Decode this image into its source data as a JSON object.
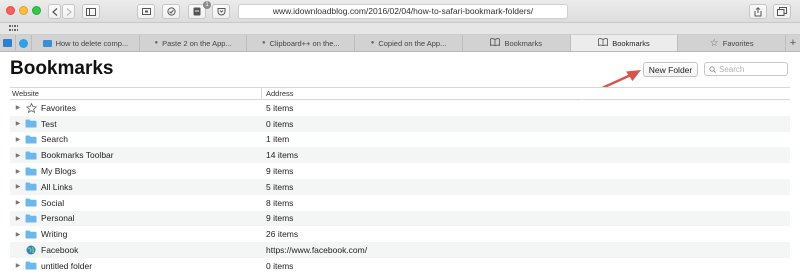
{
  "browser": {
    "url": "www.idownloadblog.com/2016/02/04/how-to-safari-bookmark-folders/",
    "badge_count": "1"
  },
  "tabs": [
    {
      "label": "How to delete comp...",
      "icon": "blue-favicon",
      "active": false
    },
    {
      "label": "Paste 2 on the App...",
      "icon": "apple-icon",
      "active": false
    },
    {
      "label": "Clipboard++ on the...",
      "icon": "apple-icon",
      "active": false
    },
    {
      "label": "Copied on the App...",
      "icon": "apple-icon",
      "active": false
    },
    {
      "label": "Bookmarks",
      "icon": "book-icon",
      "active": false
    },
    {
      "label": "Bookmarks",
      "icon": "book-icon",
      "active": true
    },
    {
      "label": "Favorites",
      "icon": "star-icon",
      "active": false
    }
  ],
  "page": {
    "title": "Bookmarks",
    "new_folder_label": "New Folder",
    "search_placeholder": "Search"
  },
  "table": {
    "headers": {
      "website": "Website",
      "address": "Address"
    },
    "rows": [
      {
        "name": "Favorites",
        "address": "5 items",
        "icon": "star-icon",
        "expandable": true
      },
      {
        "name": "Test",
        "address": "0 items",
        "icon": "folder-icon",
        "expandable": true
      },
      {
        "name": "Search",
        "address": "1 item",
        "icon": "folder-icon",
        "expandable": true
      },
      {
        "name": "Bookmarks Toolbar",
        "address": "14 items",
        "icon": "folder-icon",
        "expandable": true
      },
      {
        "name": "My Blogs",
        "address": "9 items",
        "icon": "folder-icon",
        "expandable": true
      },
      {
        "name": "All Links",
        "address": "5 items",
        "icon": "folder-icon",
        "expandable": true
      },
      {
        "name": "Social",
        "address": "8 items",
        "icon": "folder-icon",
        "expandable": true
      },
      {
        "name": "Personal",
        "address": "9 items",
        "icon": "folder-icon",
        "expandable": true
      },
      {
        "name": "Writing",
        "address": "26 items",
        "icon": "folder-icon",
        "expandable": true
      },
      {
        "name": "Facebook",
        "address": "https://www.facebook.com/",
        "icon": "globe-icon",
        "expandable": false
      },
      {
        "name": "untitled folder",
        "address": "0 items",
        "icon": "folder-icon",
        "expandable": true
      }
    ]
  },
  "colors": {
    "folder": "#6fb7ea",
    "annotation_arrow": "#d9534f"
  }
}
